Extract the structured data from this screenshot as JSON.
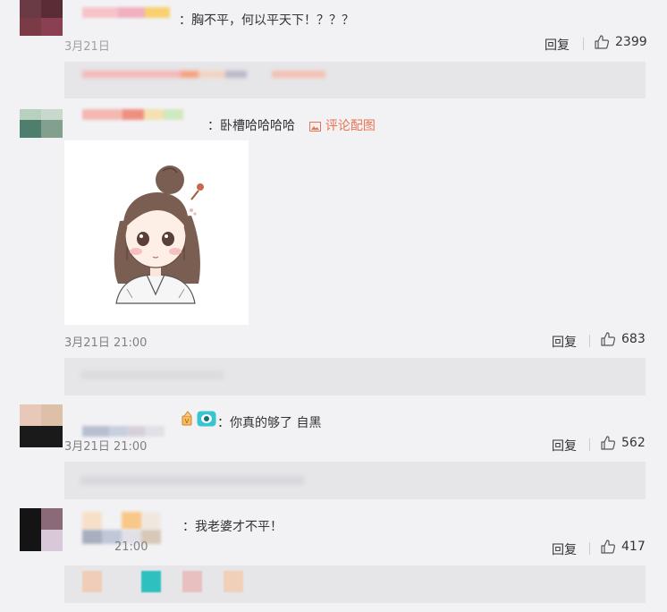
{
  "comments": [
    {
      "text": "：胸不平，何以平天下！？？？",
      "time": "3月21日",
      "reply_label": "回复",
      "likes": "2399"
    },
    {
      "text": "：卧槽哈哈哈哈",
      "image_link": "评论配图",
      "time": "3月21日 21:00",
      "reply_label": "回复",
      "likes": "683"
    },
    {
      "text": "：你真的够了 自黑",
      "time": "3月21日 21:00",
      "reply_label": "回复",
      "likes": "562"
    },
    {
      "text": "：我老婆才不平！",
      "time": "21:00",
      "reply_label": "回复",
      "likes": "417"
    }
  ],
  "colors": {
    "page_bg": "#f2f2f5",
    "subreply_bg": "#e6e6e9",
    "link": "#eb7350",
    "time": "#808080"
  },
  "icons": [
    "thumbs-up-icon",
    "image-icon",
    "badge-icon",
    "eye-emoji-icon"
  ]
}
